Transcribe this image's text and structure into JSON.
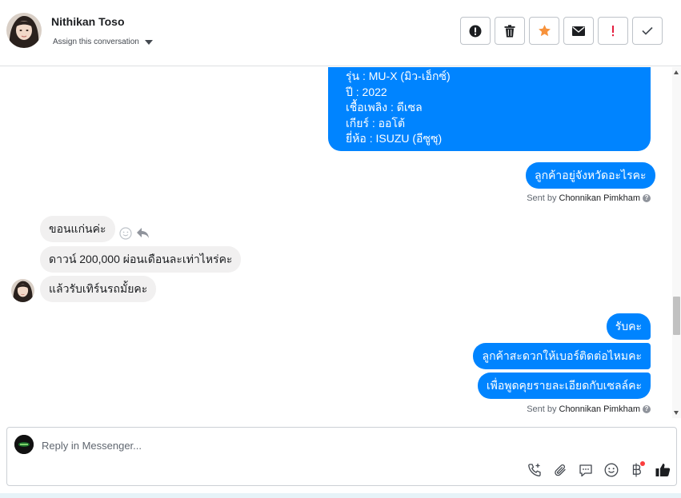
{
  "header": {
    "contact_name": "Nithikan Toso",
    "assign_label": "Assign this conversation",
    "actions": [
      {
        "name": "info-button",
        "icon": "exclamation-circle-icon"
      },
      {
        "name": "delete-button",
        "icon": "trash-icon"
      },
      {
        "name": "star-button",
        "icon": "star-icon",
        "color": "#f7923b"
      },
      {
        "name": "mark-unread-button",
        "icon": "envelope-icon"
      },
      {
        "name": "mark-spam-button",
        "icon": "exclamation-icon",
        "color": "#e41e3f"
      },
      {
        "name": "mark-done-button",
        "icon": "check-icon"
      }
    ]
  },
  "messages": {
    "outgoing_1_lines": [
      "รุ่น : MU-X (มิว-เอ็กซ์)",
      "ปี : 2022",
      "เชื้อเพลิง : ดีเซล",
      "เกียร์ : ออโต้",
      "ยี่ห้อ : ISUZU (อีซูซุ)"
    ],
    "outgoing_2": "ลูกค้าอยู่จังหวัดอะไรคะ",
    "sent_by_1": {
      "prefix": "Sent by",
      "name": "Chonnikan Pimkham"
    },
    "incoming": [
      "ขอนแก่นค่ะ",
      "ดาวน์ 200,000 ผ่อนเดือนละเท่าไหร่คะ",
      "แล้วรับเทิร์นรถมั้ยคะ"
    ],
    "outgoing_3": "รับคะ",
    "outgoing_4": "ลูกค้าสะดวกให้เบอร์ติดต่อไหมคะ",
    "outgoing_5": "เพื่อพูดคุยรายละเอียดกับเซลล์คะ",
    "sent_by_2": {
      "prefix": "Sent by",
      "name": "Chonnikan Pimkham"
    },
    "help_glyph": "?"
  },
  "composer": {
    "placeholder": "Reply in Messenger...",
    "tools": [
      "phone-add-icon",
      "paperclip-icon",
      "saved-reply-icon",
      "emoji-icon",
      "baht-icon",
      "thumbs-up-icon"
    ]
  },
  "colors": {
    "outgoing_bubble": "#0084ff",
    "incoming_bubble": "#f1f0f0",
    "star": "#f7923b",
    "spam": "#e41e3f"
  }
}
